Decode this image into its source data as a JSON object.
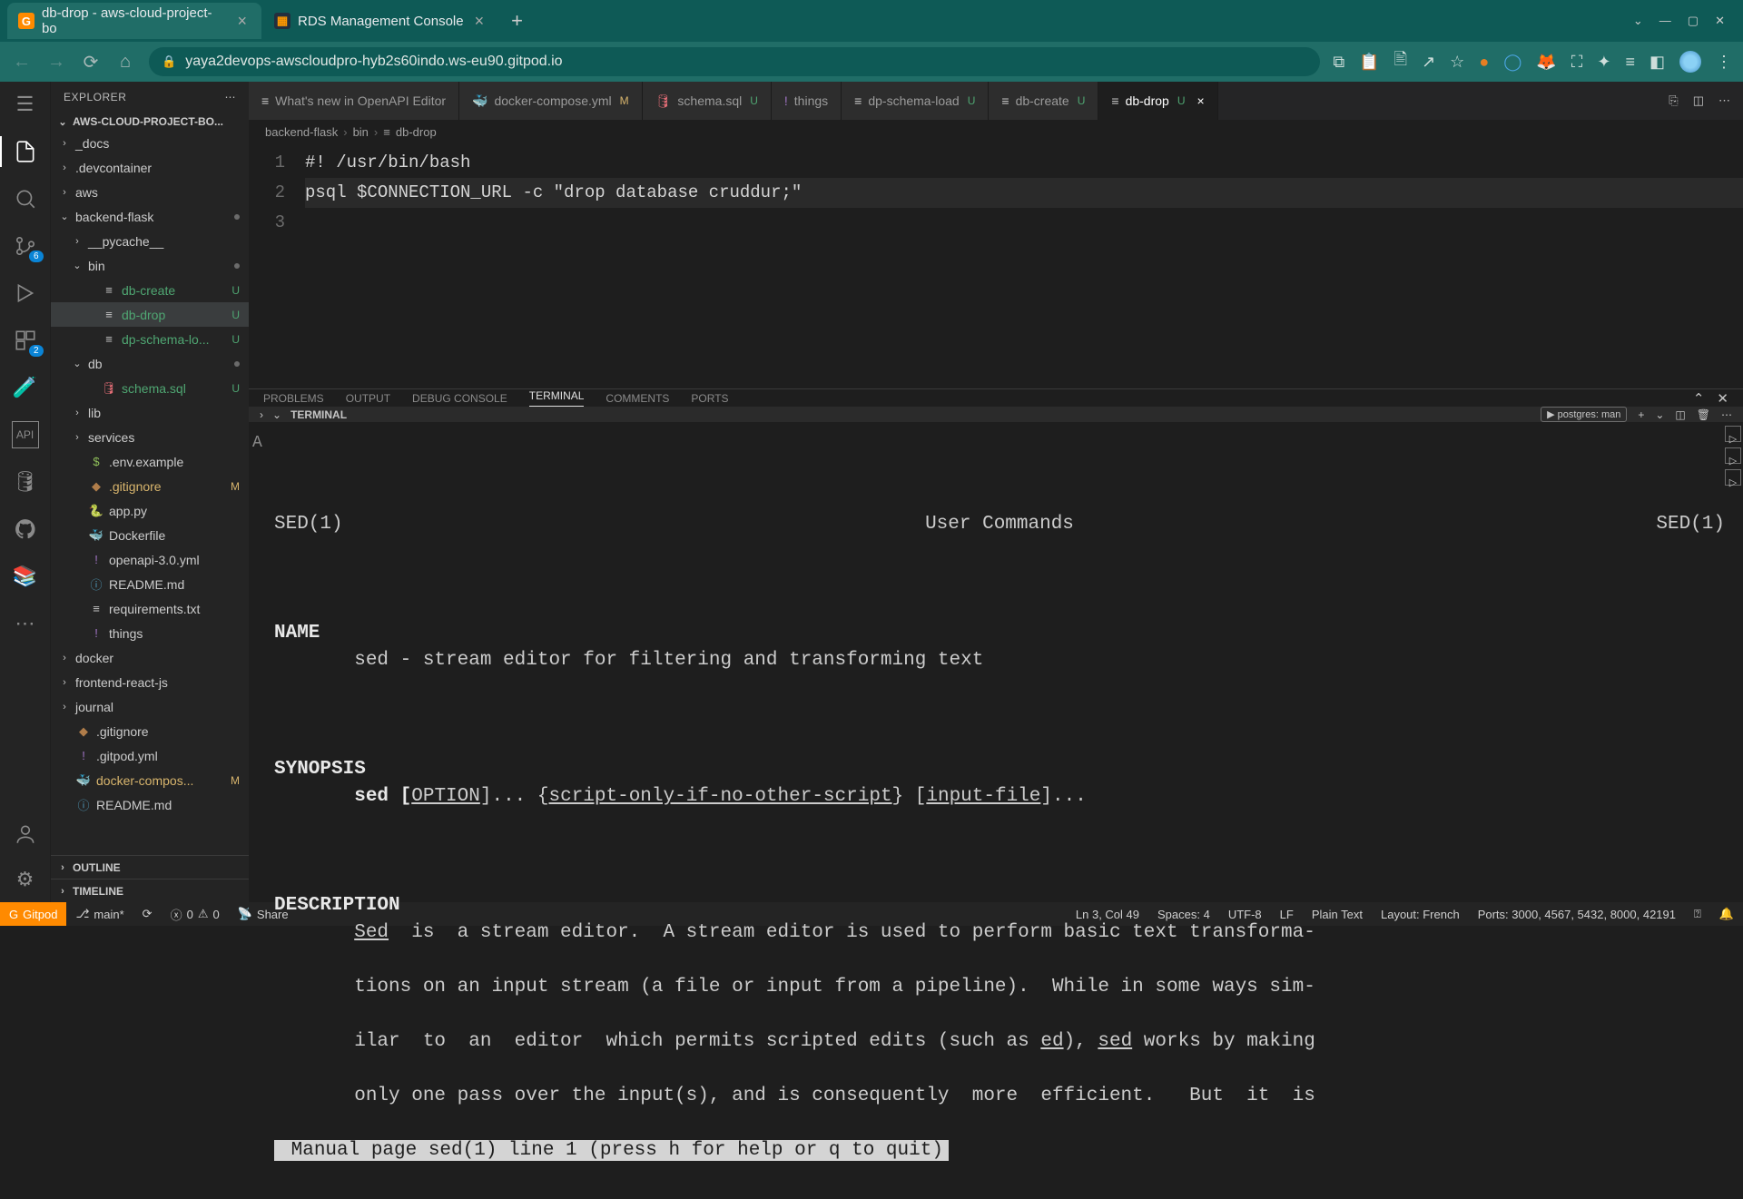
{
  "browser": {
    "tabs": [
      {
        "title": "db-drop - aws-cloud-project-bo",
        "active": true,
        "favicon": "gitpod"
      },
      {
        "title": "RDS Management Console",
        "active": false,
        "favicon": "aws"
      }
    ],
    "url": "yaya2devops-awscloudpro-hyb2s60indo.ws-eu90.gitpod.io"
  },
  "sidebar": {
    "title": "EXPLORER",
    "project": "AWS-CLOUD-PROJECT-BO...",
    "tree": [
      {
        "depth": 0,
        "kind": "folder",
        "open": false,
        "name": "_docs"
      },
      {
        "depth": 0,
        "kind": "folder",
        "open": false,
        "name": ".devcontainer"
      },
      {
        "depth": 0,
        "kind": "folder",
        "open": false,
        "name": "aws"
      },
      {
        "depth": 0,
        "kind": "folder",
        "open": true,
        "name": "backend-flask",
        "dot": true
      },
      {
        "depth": 1,
        "kind": "folder",
        "open": false,
        "name": "__pycache__"
      },
      {
        "depth": 1,
        "kind": "folder",
        "open": true,
        "name": "bin",
        "dot": true
      },
      {
        "depth": 2,
        "kind": "file",
        "icon": "≡",
        "name": "db-create",
        "git": "U"
      },
      {
        "depth": 2,
        "kind": "file",
        "icon": "≡",
        "name": "db-drop",
        "git": "U",
        "selected": true
      },
      {
        "depth": 2,
        "kind": "file",
        "icon": "≡",
        "name": "dp-schema-lo...",
        "git": "U"
      },
      {
        "depth": 1,
        "kind": "folder",
        "open": true,
        "name": "db",
        "dot": true
      },
      {
        "depth": 2,
        "kind": "file",
        "icon": "🛢",
        "iconColor": "#e06c75",
        "name": "schema.sql",
        "git": "U"
      },
      {
        "depth": 1,
        "kind": "folder",
        "open": false,
        "name": "lib"
      },
      {
        "depth": 1,
        "kind": "folder",
        "open": false,
        "name": "services"
      },
      {
        "depth": 1,
        "kind": "file",
        "icon": "$",
        "iconColor": "#8fbf5a",
        "name": ".env.example"
      },
      {
        "depth": 1,
        "kind": "file",
        "icon": "◆",
        "iconColor": "#b07d4a",
        "name": ".gitignore",
        "git": "M"
      },
      {
        "depth": 1,
        "kind": "file",
        "icon": "🐍",
        "iconColor": "#519aba",
        "name": "app.py"
      },
      {
        "depth": 1,
        "kind": "file",
        "icon": "🐳",
        "iconColor": "#519aba",
        "name": "Dockerfile"
      },
      {
        "depth": 1,
        "kind": "file",
        "icon": "!",
        "iconColor": "#a074c4",
        "name": "openapi-3.0.yml"
      },
      {
        "depth": 1,
        "kind": "file",
        "icon": "ⓘ",
        "iconColor": "#519aba",
        "name": "README.md"
      },
      {
        "depth": 1,
        "kind": "file",
        "icon": "≡",
        "name": "requirements.txt"
      },
      {
        "depth": 1,
        "kind": "file",
        "icon": "!",
        "iconColor": "#a074c4",
        "name": "things"
      },
      {
        "depth": 0,
        "kind": "folder",
        "open": false,
        "name": "docker"
      },
      {
        "depth": 0,
        "kind": "folder",
        "open": false,
        "name": "frontend-react-js"
      },
      {
        "depth": 0,
        "kind": "folder",
        "open": false,
        "name": "journal"
      },
      {
        "depth": 0,
        "kind": "file",
        "icon": "◆",
        "iconColor": "#b07d4a",
        "name": ".gitignore"
      },
      {
        "depth": 0,
        "kind": "file",
        "icon": "!",
        "iconColor": "#a074c4",
        "name": ".gitpod.yml"
      },
      {
        "depth": 0,
        "kind": "file",
        "icon": "🐳",
        "iconColor": "#e06c75",
        "name": "docker-compos...",
        "git": "M"
      },
      {
        "depth": 0,
        "kind": "file",
        "icon": "ⓘ",
        "iconColor": "#519aba",
        "name": "README.md"
      }
    ],
    "outline": "OUTLINE",
    "timeline": "TIMELINE"
  },
  "editor_tabs": [
    {
      "icon": "≡",
      "label": "What's new in OpenAPI Editor"
    },
    {
      "icon": "🐳",
      "iconColor": "#e06c75",
      "label": "docker-compose.yml",
      "git": "M"
    },
    {
      "icon": "🛢",
      "iconColor": "#e06c75",
      "label": "schema.sql",
      "git": "U"
    },
    {
      "icon": "!",
      "iconColor": "#a074c4",
      "label": "things"
    },
    {
      "icon": "≡",
      "label": "dp-schema-load",
      "git": "U"
    },
    {
      "icon": "≡",
      "label": "db-create",
      "git": "U"
    },
    {
      "icon": "≡",
      "label": "db-drop",
      "git": "U",
      "active": true,
      "close": true
    }
  ],
  "breadcrumb": {
    "parts": [
      "backend-flask",
      "bin",
      "db-drop"
    ],
    "finalIcon": "≡"
  },
  "code": {
    "lines": [
      "1",
      "2",
      "3"
    ],
    "l1": "#! /usr/bin/bash",
    "l2": "",
    "l3": "psql $CONNECTION_URL -c \"drop database cruddur;\""
  },
  "panel": {
    "tabs": [
      "PROBLEMS",
      "OUTPUT",
      "DEBUG CONSOLE",
      "TERMINAL",
      "COMMENTS",
      "PORTS"
    ],
    "active": "TERMINAL",
    "toolbar_label": "TERMINAL",
    "profile_label": "postgres: man",
    "terminal": {
      "header_left": "SED(1)",
      "header_center": "User Commands",
      "header_right": "SED(1)",
      "name_hdr": "NAME",
      "name_body": "       sed - stream editor for filtering and transforming text",
      "syn_hdr": "SYNOPSIS",
      "syn_pre": "       sed [",
      "syn_opt": "OPTION",
      "syn_mid1": "]... {",
      "syn_script": "script-only-if-no-other-script",
      "syn_mid2": "} [",
      "syn_file": "input-file",
      "syn_end": "]...",
      "desc_hdr": "DESCRIPTION",
      "desc_pre": "       ",
      "desc_sed": "Sed",
      "desc_l1b": "  is  a stream editor.  A stream editor is used to perform basic text transforma-",
      "desc_l2": "       tions on an input stream (a file or input from a pipeline).  While in some ways sim-",
      "desc_l3a": "       ilar  to  an  editor  which permits scripted edits (such as ",
      "desc_ed": "ed",
      "desc_l3b": "), ",
      "desc_sed2": "sed",
      "desc_l3c": " works by making",
      "desc_l4": "       only one pass over the input(s), and is consequently  more  efficient.   But  it  is",
      "status": " Manual page sed(1) line 1 (press h for help or q to quit)"
    }
  },
  "statusbar": {
    "gitpod": "Gitpod",
    "branch": "main*",
    "problems": "0",
    "warnings": "0",
    "share": "Share",
    "cursor": "Ln 3, Col 49",
    "spaces": "Spaces: 4",
    "encoding": "UTF-8",
    "eol": "LF",
    "lang": "Plain Text",
    "layout": "Layout: French",
    "ports": "Ports: 3000, 4567, 5432, 8000, 42191"
  }
}
